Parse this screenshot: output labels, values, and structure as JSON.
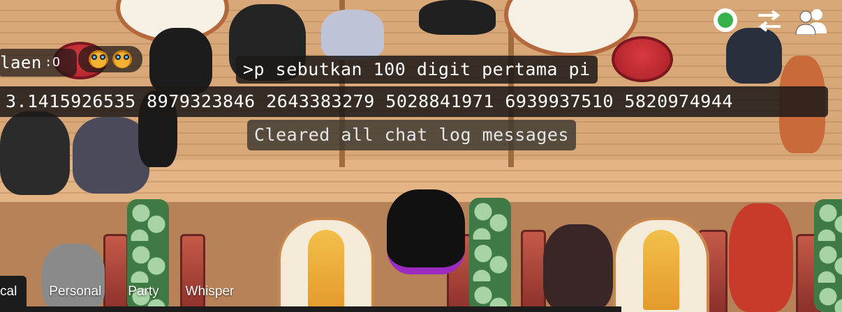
{
  "chat": {
    "name_tag": "laen",
    "name_tag_suffix": ":O",
    "command_line": ">p sebutkan 100 digit pertama pi",
    "pi_line": "3.1415926535 8979323846 2643383279 5028841971 6939937510 5820974944",
    "system_line": "Cleared all chat log messages"
  },
  "status": {
    "online_color": "#35b24a",
    "online_icon": "status-online-icon",
    "swap_icon": "swap-arrows-icon",
    "people_icon": "friends-icon"
  },
  "tabs": [
    {
      "label": "cal",
      "active": true
    },
    {
      "label": "Personal",
      "active": false
    },
    {
      "label": "Party",
      "active": false
    },
    {
      "label": "Whisper",
      "active": false
    }
  ],
  "colors": {
    "bubble_bg": "#1c1816",
    "tab_bar": "#1c1c1c"
  }
}
